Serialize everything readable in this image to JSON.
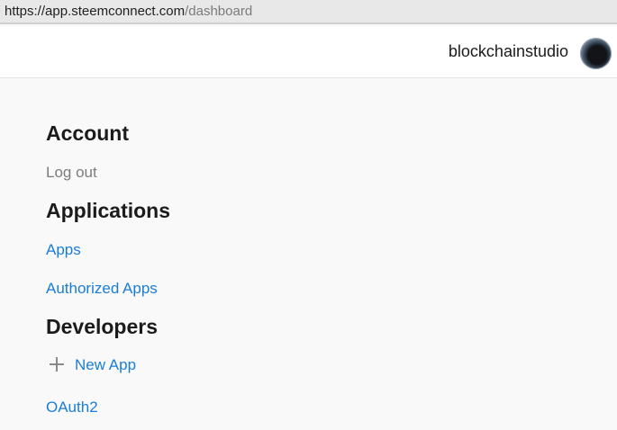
{
  "browser": {
    "url_host": "https://app.steemconnect.com",
    "url_path": "/dashboard"
  },
  "header": {
    "username": "blockchainstudio",
    "avatar_icon": "user-avatar"
  },
  "sections": {
    "account": {
      "title": "Account",
      "logout_label": "Log out"
    },
    "applications": {
      "title": "Applications",
      "apps_label": "Apps",
      "authorized_apps_label": "Authorized Apps"
    },
    "developers": {
      "title": "Developers",
      "new_app_label": "New App",
      "oauth2_label": "OAuth2"
    }
  },
  "colors": {
    "link": "#1a7dd7",
    "heading": "#1b1b1b",
    "muted": "#7c7c7c",
    "background": "#f9f9f9"
  }
}
